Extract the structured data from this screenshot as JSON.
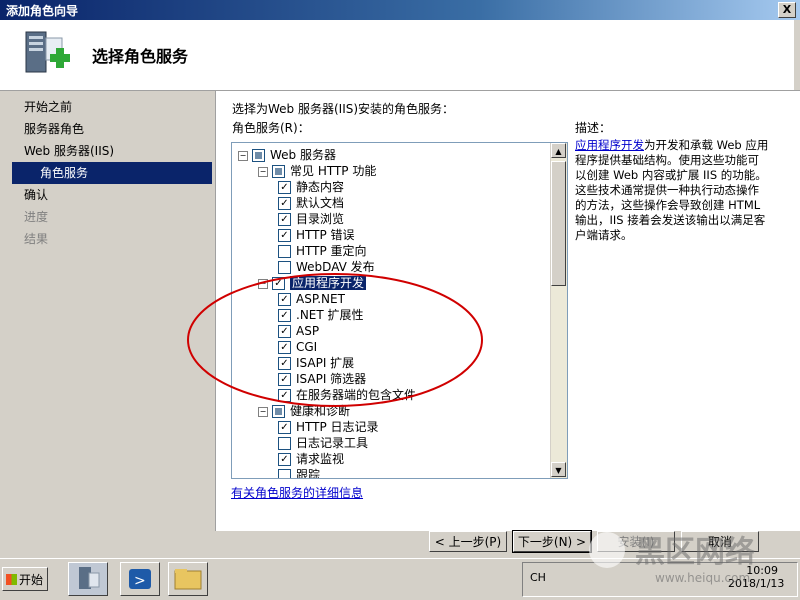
{
  "window": {
    "title": "添加角色向导",
    "close_glyph": "X"
  },
  "header": {
    "title": "选择角色服务"
  },
  "nav": [
    {
      "label": "开始之前",
      "state": "normal"
    },
    {
      "label": "服务器角色",
      "state": "normal"
    },
    {
      "label": "Web 服务器(IIS)",
      "state": "normal"
    },
    {
      "label": "角色服务",
      "state": "selected"
    },
    {
      "label": "确认",
      "state": "normal"
    },
    {
      "label": "进度",
      "state": "disabled"
    },
    {
      "label": "结果",
      "state": "disabled"
    }
  ],
  "main": {
    "instruction": "选择为Web 服务器(IIS)安装的角色服务：",
    "list_label": "角色服务(R)：",
    "description_title": "描述：",
    "description_link": "应用程序开发",
    "description_text": "为开发和承载 Web 应用程序提供基础结构。使用这些功能可以创建 Web 内容或扩展 IIS 的功能。这些技术通常提供一种执行动态操作的方法，这些操作会导致创建 HTML 输出，IIS 接着会发送该输出以满足客户端请求。",
    "more_info_link": "有关角色服务的详细信息"
  },
  "tree": [
    {
      "label": "Web 服务器",
      "state": "partial",
      "expand": "minus"
    },
    {
      "label": "常见 HTTP 功能",
      "state": "partial",
      "expand": "minus"
    },
    {
      "label": "静态内容",
      "state": "checked"
    },
    {
      "label": "默认文档",
      "state": "checked"
    },
    {
      "label": "目录浏览",
      "state": "checked"
    },
    {
      "label": "HTTP 错误",
      "state": "checked"
    },
    {
      "label": "HTTP 重定向",
      "state": "unchecked"
    },
    {
      "label": "WebDAV 发布",
      "state": "unchecked"
    },
    {
      "label": "应用程序开发",
      "state": "checked",
      "expand": "minus",
      "highlight": true
    },
    {
      "label": "ASP.NET",
      "state": "checked"
    },
    {
      "label": ".NET 扩展性",
      "state": "checked"
    },
    {
      "label": "ASP",
      "state": "checked"
    },
    {
      "label": "CGI",
      "state": "checked"
    },
    {
      "label": "ISAPI 扩展",
      "state": "checked"
    },
    {
      "label": "ISAPI 筛选器",
      "state": "checked"
    },
    {
      "label": "在服务器端的包含文件",
      "state": "checked"
    },
    {
      "label": "健康和诊断",
      "state": "partial",
      "expand": "minus"
    },
    {
      "label": "HTTP 日志记录",
      "state": "checked"
    },
    {
      "label": "日志记录工具",
      "state": "unchecked"
    },
    {
      "label": "请求监视",
      "state": "checked"
    },
    {
      "label": "跟踪",
      "state": "unchecked"
    }
  ],
  "buttons": {
    "prev": "< 上一步(P)",
    "next": "下一步(N) >",
    "install": "安装(I)",
    "cancel": "取消"
  },
  "taskbar": {
    "start": "开始",
    "lang": "CH",
    "time": "10:09",
    "date": "2018/1/13"
  },
  "watermark": {
    "text": "黑区网络",
    "url": "www.heiqu.com"
  },
  "colors": {
    "selection": "#0a246a",
    "link": "#0000cc",
    "annotation": "#d00000"
  },
  "icons": [
    "server-add-icon",
    "checkbox",
    "expander-minus",
    "start-flag-icon",
    "server-manager-icon",
    "powershell-icon",
    "explorer-icon"
  ]
}
